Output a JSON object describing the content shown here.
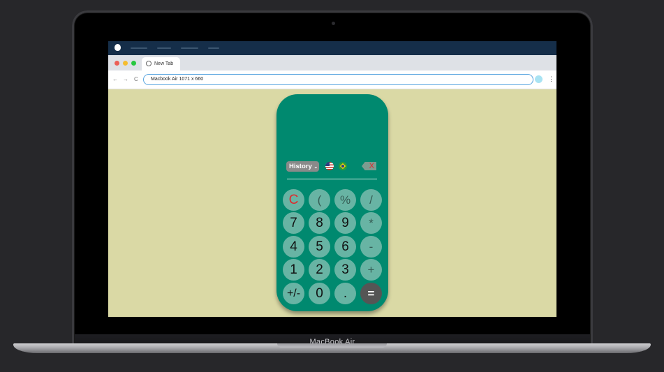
{
  "device": {
    "label": "MacBook Air"
  },
  "browser": {
    "tab_title": "New Tab",
    "address": "Macbook Air   1071 x 660",
    "nav": {
      "back": "←",
      "forward": "→",
      "reload": "C"
    },
    "menu": "⋮"
  },
  "calculator": {
    "history_label": "History",
    "backspace_label": "X",
    "keys": [
      {
        "label": "C",
        "type": "clear"
      },
      {
        "label": "(",
        "type": "op"
      },
      {
        "label": "%",
        "type": "op"
      },
      {
        "label": "/",
        "type": "op"
      },
      {
        "label": "7",
        "type": "num"
      },
      {
        "label": "8",
        "type": "num"
      },
      {
        "label": "9",
        "type": "num"
      },
      {
        "label": "*",
        "type": "op"
      },
      {
        "label": "4",
        "type": "num"
      },
      {
        "label": "5",
        "type": "num"
      },
      {
        "label": "6",
        "type": "num"
      },
      {
        "label": "-",
        "type": "op"
      },
      {
        "label": "1",
        "type": "num"
      },
      {
        "label": "2",
        "type": "num"
      },
      {
        "label": "3",
        "type": "num"
      },
      {
        "label": "+",
        "type": "op"
      },
      {
        "label": "+/-",
        "type": "sign"
      },
      {
        "label": "0",
        "type": "num"
      },
      {
        "label": ".",
        "type": "num"
      },
      {
        "label": "=",
        "type": "equals"
      }
    ],
    "flags": [
      "us-flag-icon",
      "brazil-flag-icon"
    ]
  },
  "colors": {
    "page_bg": "#dad9a5",
    "calculator_bg": "#00896f",
    "key_bg": "#68b4a4",
    "clear_red": "#e0292c",
    "equals_bg": "#555555"
  }
}
